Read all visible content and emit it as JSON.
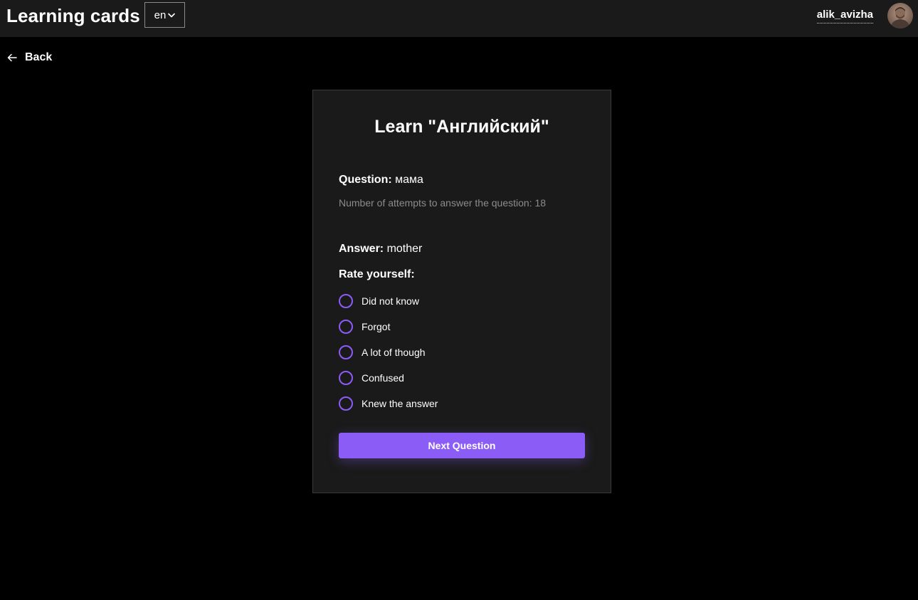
{
  "header": {
    "app_title": "Learning cards",
    "language": "en",
    "username": "alik_avizha"
  },
  "nav": {
    "back_label": "Back"
  },
  "card": {
    "title": "Learn \"Английский\"",
    "question_label": "Question:",
    "question_value": "мама",
    "attempts_text": "Number of attempts to answer the question: 18",
    "answer_label": "Answer:",
    "answer_value": "mother",
    "rate_label": "Rate yourself:",
    "options": [
      {
        "label": "Did not know"
      },
      {
        "label": "Forgot"
      },
      {
        "label": "A lot of though"
      },
      {
        "label": "Confused"
      },
      {
        "label": "Knew the answer"
      }
    ],
    "next_label": "Next Question"
  },
  "colors": {
    "accent": "#8b5cf6",
    "background": "#000000",
    "surface": "#1a1a1a",
    "muted_text": "#8c8c8c"
  }
}
